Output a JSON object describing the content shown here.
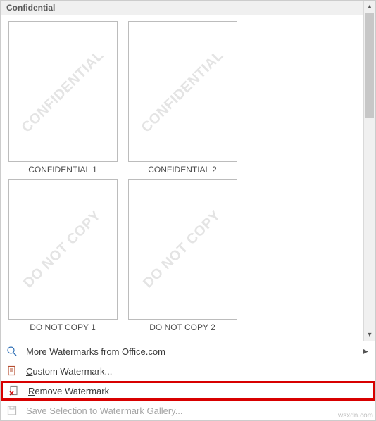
{
  "section_header": "Confidential",
  "watermarks": [
    {
      "wm_text": "CONFIDENTIAL",
      "caption": "CONFIDENTIAL 1"
    },
    {
      "wm_text": "CONFIDENTIAL",
      "caption": "CONFIDENTIAL 2"
    },
    {
      "wm_text": "DO NOT COPY",
      "caption": "DO NOT COPY 1"
    },
    {
      "wm_text": "DO NOT COPY",
      "caption": "DO NOT COPY 2"
    }
  ],
  "menu": {
    "more": "More Watermarks from Office.com",
    "custom": "Custom Watermark...",
    "remove": "Remove Watermark",
    "save": "Save Selection to Watermark Gallery..."
  },
  "attribution": "wsxdn.com"
}
